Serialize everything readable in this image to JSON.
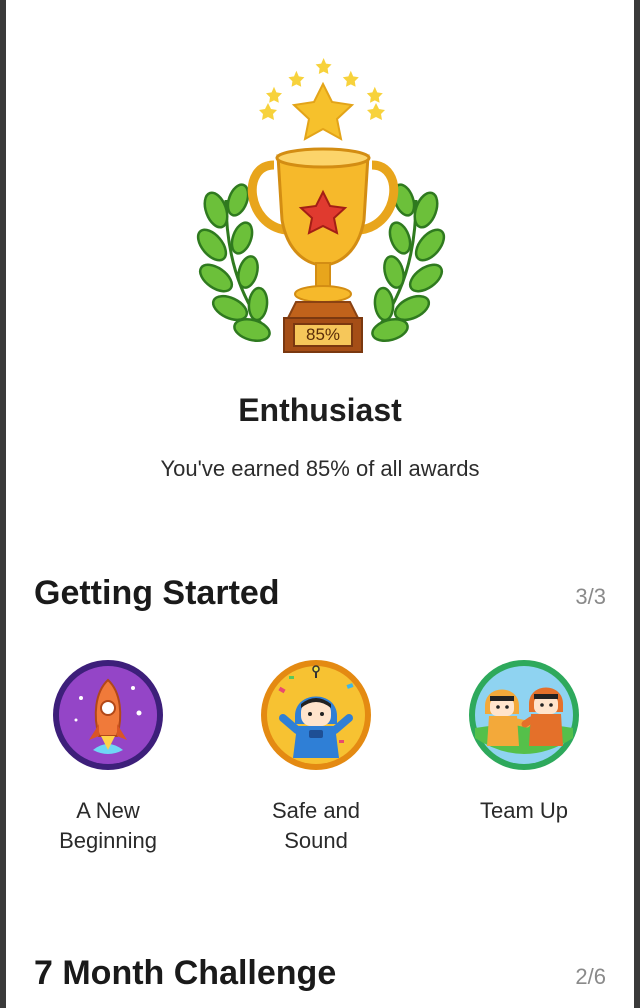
{
  "hero": {
    "trophy_percent": "85%",
    "level_title": "Enthusiast",
    "level_subtitle": "You've earned 85% of all awards"
  },
  "sections": [
    {
      "title": "Getting Started",
      "count": "3/3",
      "badges": [
        {
          "label": "A New\nBeginning",
          "icon": "rocket-icon",
          "ring_color": "#4a1f8c"
        },
        {
          "label": "Safe and\nSound",
          "icon": "astronaut-icon",
          "ring_color": "#f0a81a"
        },
        {
          "label": "Team Up",
          "icon": "team-icon",
          "ring_color": "#3bb36a"
        }
      ]
    },
    {
      "title": "7 Month Challenge",
      "count": "2/6"
    }
  ],
  "colors": {
    "trophy_gold": "#f6b92b",
    "laurel_green": "#5cb531",
    "star_yellow": "#f7d23c",
    "count_gray": "#8a8a8a"
  }
}
